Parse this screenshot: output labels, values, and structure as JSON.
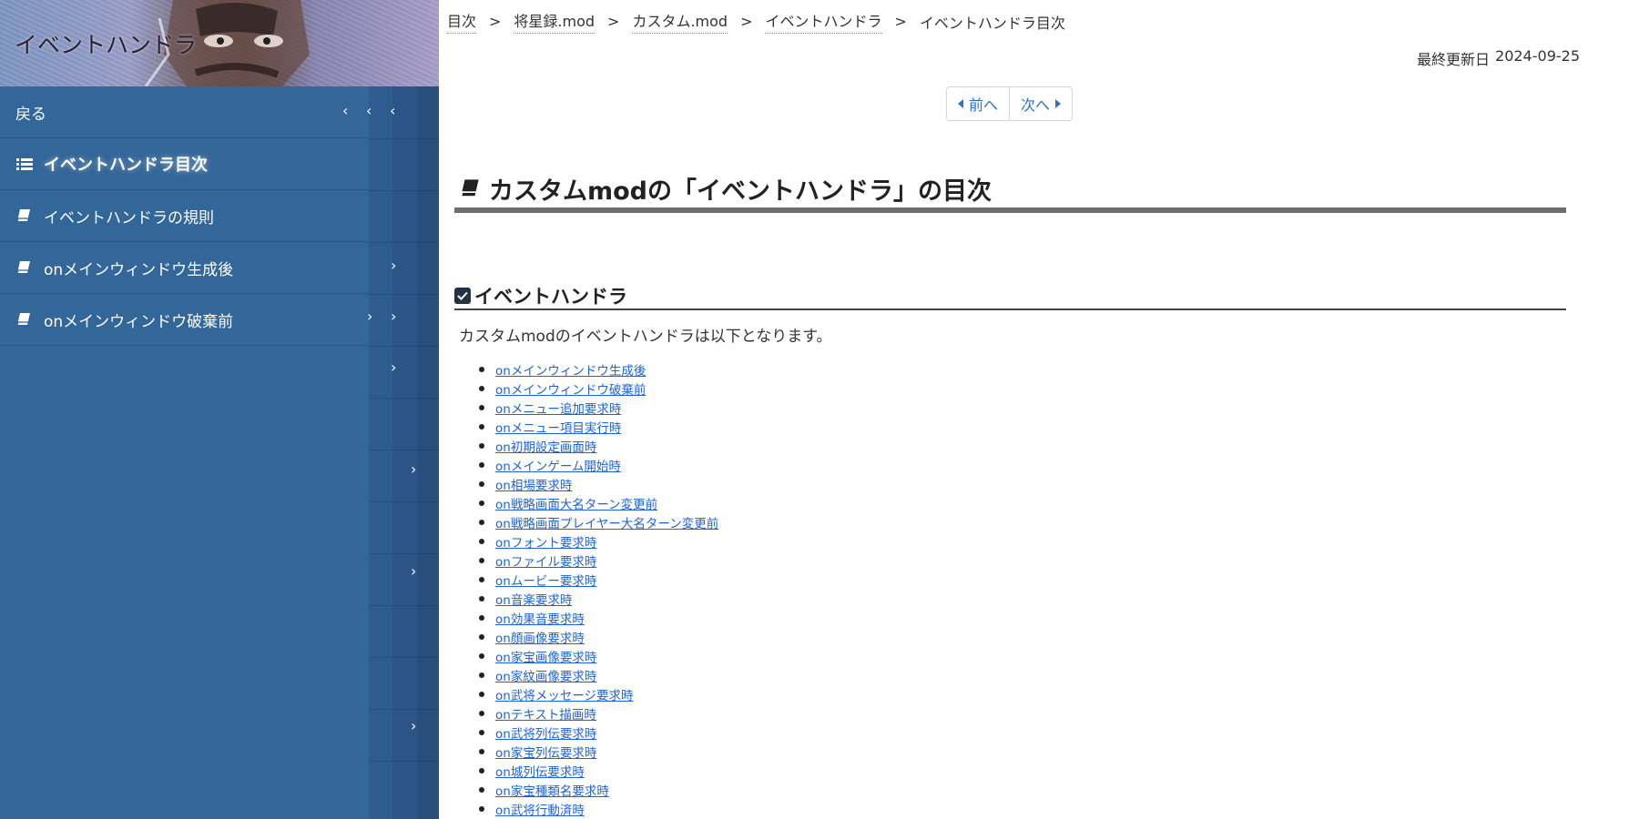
{
  "sidebar": {
    "title": "イベントハンドラ",
    "back_label": "戻る",
    "items": [
      {
        "label": "イベントハンドラ目次",
        "icon": "list-icon",
        "active": true
      },
      {
        "label": "イベントハンドラの規則",
        "icon": "book-icon",
        "active": false
      },
      {
        "label": "onメインウィンドウ生成後",
        "icon": "book-icon",
        "active": false
      },
      {
        "label": "onメインウィンドウ破棄前",
        "icon": "book-icon",
        "active": false
      }
    ]
  },
  "breadcrumb": {
    "items": [
      "目次",
      "将星録.mod",
      "カスタム.mod",
      "イベントハンドラ"
    ],
    "separator": ">",
    "current": "イベントハンドラ目次"
  },
  "updated": {
    "label": "最終更新日",
    "date": "2024-09-25"
  },
  "pager": {
    "prev_label": "前へ",
    "next_label": "次へ"
  },
  "main": {
    "title": "カスタムmodの「イベントハンドラ」の目次",
    "section_heading": "イベントハンドラ",
    "intro": "カスタムmodのイベントハンドラは以下となります。",
    "handlers": [
      "onメインウィンドウ生成後",
      "onメインウィンドウ破棄前",
      "onメニュー追加要求時",
      "onメニュー項目実行時",
      "on初期設定画面時",
      "onメインゲーム開始時",
      "on相場要求時",
      "on戦略画面大名ターン変更前",
      "on戦略画面プレイヤー大名ターン変更前",
      "onフォント要求時",
      "onファイル要求時",
      "onムービー要求時",
      "on音楽要求時",
      "on効果音要求時",
      "on顔画像要求時",
      "on家宝画像要求時",
      "on家紋画像要求時",
      "on武将メッセージ要求時",
      "onテキスト描画時",
      "on武将列伝要求時",
      "on家宝列伝要求時",
      "on城列伝要求時",
      "on家宝種類名要求時",
      "on武将行動済時"
    ]
  },
  "colors": {
    "sidebar_bg": "#336699",
    "link": "#1f63d6",
    "title_rule": "#6f6f6f"
  }
}
